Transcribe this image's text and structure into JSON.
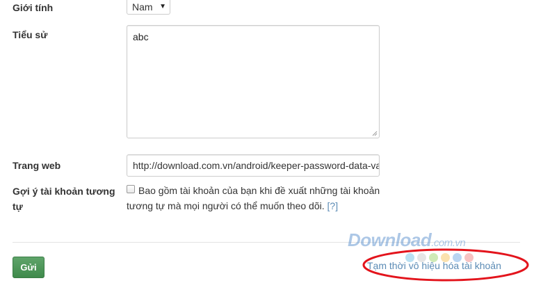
{
  "fields": {
    "gender": {
      "label": "Giới tính",
      "value": "Nam",
      "caret": "▼"
    },
    "bio": {
      "label": "Tiểu sử",
      "value": "abc"
    },
    "website": {
      "label": "Trang web",
      "value": "http://download.com.vn/android/keeper-password-data-vault"
    },
    "suggest": {
      "label": "Gợi ý tài khoản tương tự",
      "checked": false,
      "text": "Bao gồm tài khoản của bạn khi đề xuất những tài khoản tương tự mà mọi người có thể muốn theo dõi.",
      "help": "[?]"
    }
  },
  "actions": {
    "submit_label": "Gửi",
    "deactivate_label": "Tạm thời vô hiệu hóa tài khoản"
  },
  "watermark": {
    "main": "Download",
    "suffix": ".com.vn"
  },
  "colors": {
    "submit": "#4a9556",
    "link": "#5b8bb5",
    "annotation": "#e3141c"
  }
}
